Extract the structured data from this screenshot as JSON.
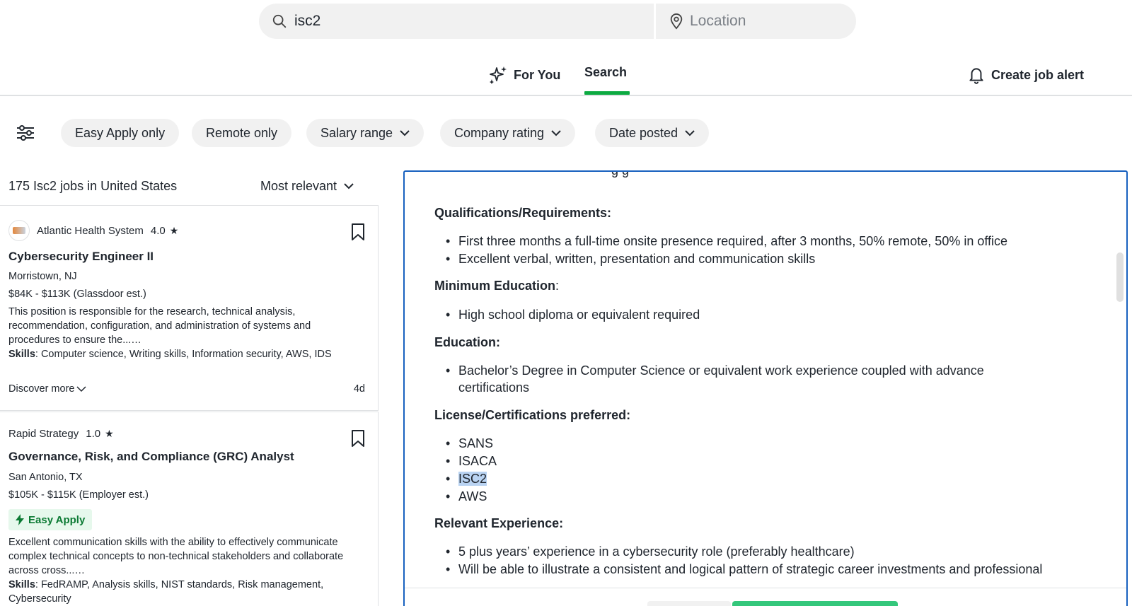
{
  "search": {
    "query": "isc2",
    "location_placeholder": "Location"
  },
  "tabs": {
    "for_you": "For You",
    "search": "Search",
    "create_alert": "Create job alert"
  },
  "filters": [
    "Easy Apply only",
    "Remote only",
    "Salary range",
    "Company rating",
    "Date posted"
  ],
  "results": {
    "count_text": "175 Isc2 jobs in United States",
    "sort_label": "Most relevant"
  },
  "jobs": [
    {
      "company": "Atlantic Health System",
      "rating": "4.0",
      "title": "Cybersecurity Engineer II",
      "location": "Morristown, NJ",
      "salary": "$84K - $113K (Glassdoor est.)",
      "description": "This position is responsible for the research, technical analysis, recommendation, configuration, and administration of systems and procedures to ensure the...…",
      "skills_label": "Skills",
      "skills": ": Computer science, Writing skills, Information security, AWS, IDS",
      "discover": "Discover more",
      "age": "4d"
    },
    {
      "company": "Rapid Strategy",
      "rating": "1.0",
      "title": "Governance, Risk, and Compliance (GRC) Analyst",
      "location": "San Antonio, TX",
      "salary": "$105K - $115K (Employer est.)",
      "badge": "Easy Apply",
      "description": "Excellent communication skills with the ability to effectively communicate complex technical concepts to non-technical stakeholders and collaborate across cross...…",
      "skills_label": "Skills",
      "skills": ": FedRAMP, Analysis skills, NIST standards, Risk management, Cybersecurity"
    }
  ],
  "detail": {
    "cut_text": "g                              g",
    "qual_heading": "Qualifications/Requirements:",
    "qual_items": [
      "First three months a full-time onsite presence required, after 3 months, 50% remote, 50% in office",
      "Excellent verbal, written, presentation and communication skills"
    ],
    "min_edu_heading": "Minimum Education",
    "min_edu_colon": ":",
    "min_edu_items": [
      "High school diploma or equivalent required"
    ],
    "edu_heading": "Education:",
    "edu_items": [
      "Bachelor’s Degree in Computer Science or equivalent work experience coupled with advance certifications"
    ],
    "license_heading": "License/Certifications preferred:",
    "license_items": [
      "SANS",
      "ISACA",
      "ISC2",
      "AWS"
    ],
    "exp_heading": "Relevant Experience:",
    "exp_items": [
      "5 plus years’ experience in a cybersecurity role (preferably healthcare)",
      "Will be able to illustrate a consistent and logical pattern of strategic career investments and professional"
    ]
  },
  "colors": {
    "accent_green": "#0caa41",
    "focus_blue": "#1861bf",
    "highlight": "#b9d3f2"
  }
}
